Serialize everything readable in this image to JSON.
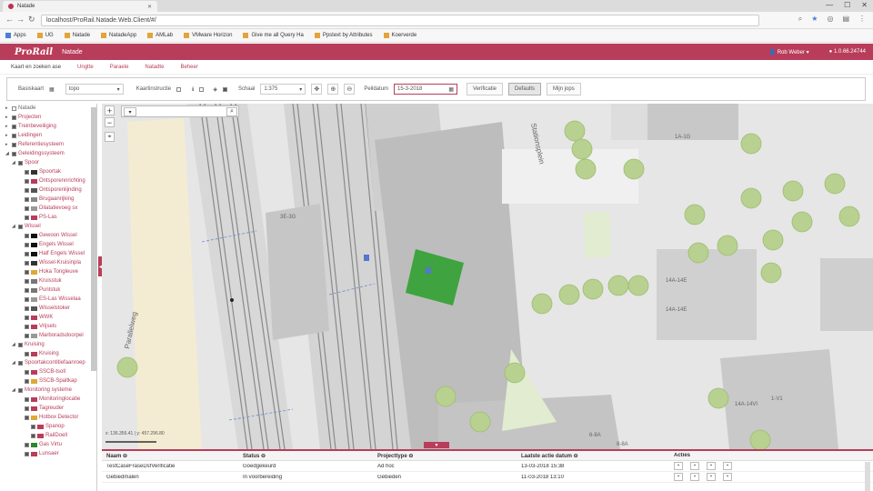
{
  "browser": {
    "tab_title": "Natade",
    "url": "localhost/ProRail.Natade.Web.Client/#/",
    "bookmarks": [
      {
        "label": "Apps"
      },
      {
        "label": "UG"
      },
      {
        "label": "Natade"
      },
      {
        "label": "NatadeApp"
      },
      {
        "label": "AMLab"
      },
      {
        "label": "VMware Horizon"
      },
      {
        "label": "Give me all Query Ha"
      },
      {
        "label": "Ppstext by Attributes"
      },
      {
        "label": "Koerverde"
      }
    ]
  },
  "header": {
    "logo": "ProRail",
    "app_name": "Natade",
    "user": "Rob Weber",
    "version": "1.0.66.24744"
  },
  "menu": [
    "Kaart en zoeken ase",
    "Ungtte",
    "Paraele",
    "Natadte",
    "Beheer"
  ],
  "toolbar": {
    "basiskaart_label": "Basiskaart",
    "basiskaart_value": "topo",
    "kaartinstr_label": "Kaartinstructie",
    "schaal_label": "Schaal",
    "schaal_value": "1:375",
    "peildatum_label": "Peildatum",
    "peildatum_value": "15-3-2018",
    "btn_verificatie": "Verificatie",
    "btn_defaults": "Defaults",
    "btn_mijn_jopps": "Mijn jops"
  },
  "tree": [
    {
      "label": "Natade",
      "i": 0,
      "root": true
    },
    {
      "label": "Projecten",
      "i": 0
    },
    {
      "label": "Treinbeveiliging",
      "i": 0
    },
    {
      "label": "Leidingen",
      "i": 0
    },
    {
      "label": "Referentiesysteem",
      "i": 0
    },
    {
      "label": "Geleidingssysteem",
      "i": 0,
      "open": true
    },
    {
      "label": "Spoor",
      "i": 1,
      "open": true
    },
    {
      "label": "Spoortak",
      "i": 2,
      "sw": "#333"
    },
    {
      "label": "Ontsporennrichting",
      "i": 2,
      "sw": "#b83d5a"
    },
    {
      "label": "Ontsporenlijnding",
      "i": 2,
      "sw": "#555"
    },
    {
      "label": "Brugaanrijking",
      "i": 2,
      "sw": "#888"
    },
    {
      "label": "Dilatatievoeg sx",
      "i": 2,
      "sw": "#999"
    },
    {
      "label": "PS-Las",
      "i": 2,
      "sw": "#b83d5a"
    },
    {
      "label": "Wissel",
      "i": 1,
      "open": true
    },
    {
      "label": "Gewoon Wissel",
      "i": 2,
      "sw": "#111"
    },
    {
      "label": "Engels Wissel",
      "i": 2,
      "sw": "#111"
    },
    {
      "label": "Half Engels Wissel",
      "i": 2,
      "sw": "#111"
    },
    {
      "label": "Wissel-Kruisinpla",
      "i": 2,
      "sw": "#333"
    },
    {
      "label": "Hoka Tongleuve",
      "i": 2,
      "sw": "#ddaa33"
    },
    {
      "label": "Kruisstuk",
      "i": 2,
      "sw": "#777"
    },
    {
      "label": "Puntstuk",
      "i": 2,
      "sw": "#777"
    },
    {
      "label": "ES-Las Wisselaa",
      "i": 2,
      "sw": "#999"
    },
    {
      "label": "Wisselstoker",
      "i": 2,
      "sw": "#555"
    },
    {
      "label": "WWK",
      "i": 2,
      "sw": "#b83d5a"
    },
    {
      "label": "Vrijsels",
      "i": 2,
      "sw": "#b83d5a"
    },
    {
      "label": "Marboradsdoorpel",
      "i": 2,
      "sw": "#999"
    },
    {
      "label": "Kruising",
      "i": 1,
      "open": true
    },
    {
      "label": "Kruising",
      "i": 2,
      "sw": "#b83d5a"
    },
    {
      "label": "Spoortakcontitiefaanroep",
      "i": 1,
      "open": true
    },
    {
      "label": "SSCB-tsoll",
      "i": 2,
      "sw": "#b83d5a"
    },
    {
      "label": "SSCB-Spaltkap",
      "i": 2,
      "sw": "#ddaa33"
    },
    {
      "label": "Monitoring systeme",
      "i": 1,
      "open": true
    },
    {
      "label": "Monitoringlocatie",
      "i": 2,
      "sw": "#b83d5a"
    },
    {
      "label": "Tagreuder",
      "i": 2,
      "sw": "#b83d5a"
    },
    {
      "label": "Hotbox Detector",
      "i": 2,
      "sw": "#ddaa33"
    },
    {
      "label": "Spanop",
      "i": 3,
      "sw": "#b83d5a"
    },
    {
      "label": "RailDoell",
      "i": 3,
      "sw": "#b83d5a"
    },
    {
      "label": "Gas Virtu",
      "i": 2,
      "sw": "#2a8a2a"
    },
    {
      "label": "Lunsaer",
      "i": 2,
      "sw": "#b83d5a"
    }
  ],
  "map": {
    "scale_text": "x: 136.356.41 | y: 457.296.80",
    "area": "#3fa33f",
    "labels": {
      "stationsplein": "Stationsplein",
      "parallelweg": "Parallelweg",
      "a1": "1A-1G",
      "a2": "3E-3G",
      "a3": "14A-14E",
      "a4": "14A-14E",
      "a5": "14A-14VI",
      "a6": "6-8A",
      "a7": "8-8A",
      "a8": "1-V1"
    }
  },
  "grid": {
    "headers": [
      "Naam",
      "Status",
      "Projecttype",
      "Laatste actie datum",
      "Acties"
    ],
    "rows": [
      [
        "TestCaseFraseDsfVerificatie",
        "Goedgekeurd",
        "Ad hoc",
        "13-03-2018 15:38"
      ],
      [
        "Gebiedmalen",
        "In voorbereiding",
        "Gebieden",
        "11-03-2018 13:10"
      ]
    ]
  }
}
